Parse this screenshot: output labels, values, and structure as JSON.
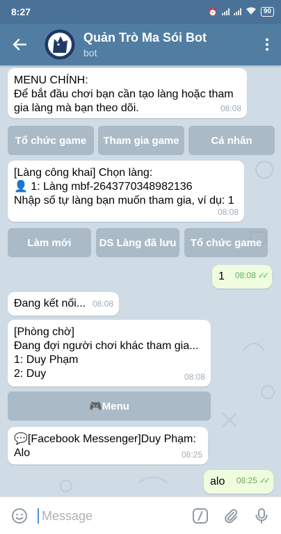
{
  "status_bar": {
    "time": "8:27",
    "battery": "90"
  },
  "header": {
    "title": "Quản Trò Ma Sói Bot",
    "subtitle": "bot"
  },
  "messages": [
    {
      "lines": [
        "MENU CHÍNH:",
        "Để bắt đầu chơi bạn cần tạo làng hoặc tham",
        "gia làng mà bạn theo dõi."
      ],
      "time": "08:08"
    },
    {
      "lines": [
        "[Làng công khai] Chọn làng:",
        "👤 1: Làng mbf-2643770348982136",
        "Nhập số tự làng bạn muốn tham gia, ví dụ: 1"
      ],
      "time": "08:08"
    },
    {
      "lines": [
        "1"
      ],
      "time": "08:08"
    },
    {
      "lines": [
        "Đang kết nối..."
      ],
      "time": "08:08"
    },
    {
      "lines": [
        "[Phòng chờ]",
        "Đang đợi người chơi khác tham gia...",
        "1: Duy Phạm",
        "2: Duy"
      ],
      "time": "08:08"
    },
    {
      "lines": [
        "💬[Facebook Messenger]Duy Phạm:",
        "Alo"
      ],
      "time": "08:25"
    },
    {
      "lines": [
        "alo"
      ],
      "time": "08:25"
    }
  ],
  "keyboard_row1": [
    "Tổ chức game",
    "Tham gia game",
    "Cá nhân"
  ],
  "keyboard_row2": [
    "Làm mới",
    "DS Làng đã lưu",
    "Tổ chức game"
  ],
  "keyboard_row3": [
    "🎮Menu"
  ],
  "input": {
    "placeholder": "Message"
  },
  "colors": {
    "header": "#517da2",
    "status_bar": "#4a7299",
    "outgoing_bubble": "#effdde",
    "chat_background": "#cfdbe5"
  },
  "icons": [
    "back-arrow-icon",
    "wolf-avatar",
    "more-vert-icon",
    "emoji-icon",
    "slash-command-icon",
    "paperclip-icon",
    "microphone-icon",
    "double-check-icon"
  ]
}
